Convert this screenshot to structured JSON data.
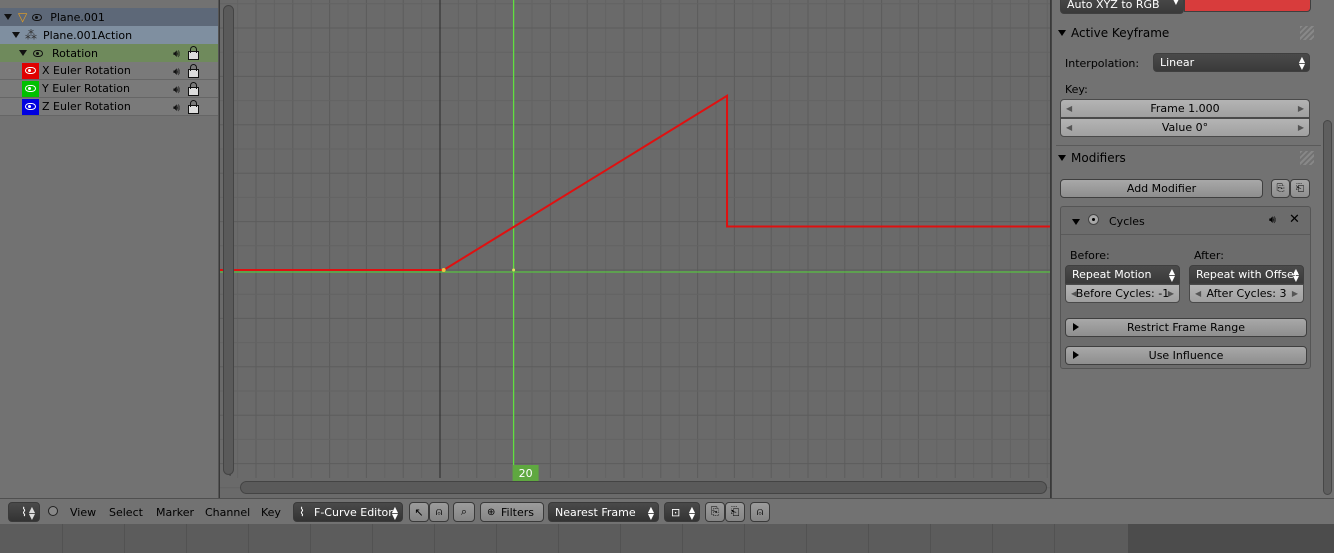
{
  "channels": {
    "items": [
      {
        "label": "Plane.001",
        "level": 0,
        "kind": "object"
      },
      {
        "label": "Plane.001Action",
        "level": 1,
        "kind": "action"
      },
      {
        "label": "Rotation",
        "level": 2,
        "kind": "group"
      },
      {
        "label": "X Euler Rotation",
        "level": 3,
        "kind": "fcurve",
        "color": "#e00000"
      },
      {
        "label": "Y Euler Rotation",
        "level": 3,
        "kind": "fcurve",
        "color": "#00c000"
      },
      {
        "label": "Z Euler Rotation",
        "level": 3,
        "kind": "fcurve",
        "color": "#0000e0"
      }
    ]
  },
  "graph": {
    "x_ticks": [
      "-50",
      "-40",
      "-30",
      "-20",
      "-10",
      "0",
      "10",
      "20",
      "30",
      "40",
      "50",
      "60",
      "70",
      "80",
      "90",
      "100",
      "110",
      "120",
      "130",
      "140",
      "150",
      "160"
    ],
    "y_ticks": [
      "500",
      "400",
      "300",
      "200",
      "100",
      "0",
      "-100",
      "-200",
      "-300",
      "-400"
    ],
    "current_frame": "20",
    "curve_color": "#e01010",
    "cursor_color": "#60e040",
    "curve_points": [
      [
        -60,
        0
      ],
      [
        1,
        0
      ],
      [
        78,
        360
      ],
      [
        78,
        90
      ],
      [
        200,
        90
      ]
    ]
  },
  "props": {
    "color_mode": "Auto XYZ to RGB",
    "active_keyframe": {
      "title": "Active Keyframe",
      "interpolation_label": "Interpolation:",
      "interpolation_value": "Linear",
      "key_label": "Key:",
      "frame": "Frame 1.000",
      "value": "Value 0°"
    },
    "modifiers": {
      "title": "Modifiers",
      "add_button": "Add Modifier",
      "cycles": {
        "name": "Cycles",
        "before_label": "Before:",
        "after_label": "After:",
        "before_mode": "Repeat Motion",
        "after_mode": "Repeat with Offset",
        "before_cycles": "Before Cycles: -1",
        "after_cycles": "After Cycles: 3",
        "restrict_label": "Restrict Frame Range",
        "influence_label": "Use Influence"
      }
    }
  },
  "header": {
    "menus": [
      "View",
      "Select",
      "Marker",
      "Channel",
      "Key"
    ],
    "mode": "F-Curve Editor",
    "filters": "Filters",
    "snap": "Nearest Frame"
  }
}
